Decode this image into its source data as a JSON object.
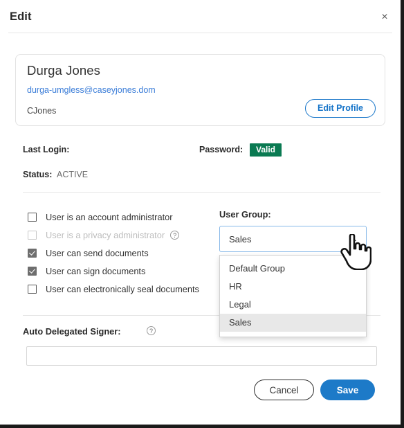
{
  "header": {
    "title": "Edit",
    "close_label": "×"
  },
  "profile": {
    "name": "Durga Jones",
    "email": "durga-umgless@caseyjones.dom",
    "username": "CJones",
    "edit_button_label": "Edit Profile"
  },
  "meta": {
    "last_login_label": "Last Login:",
    "last_login_value": "",
    "password_label": "Password:",
    "password_status": "Valid",
    "status_label": "Status:",
    "status_value": "ACTIVE"
  },
  "permissions": [
    {
      "label": "User is an account administrator",
      "checked": false,
      "disabled": false,
      "help": false
    },
    {
      "label": "User is a privacy administrator",
      "checked": false,
      "disabled": true,
      "help": true
    },
    {
      "label": "User can send documents",
      "checked": true,
      "disabled": false,
      "help": false
    },
    {
      "label": "User can sign documents",
      "checked": true,
      "disabled": false,
      "help": false
    },
    {
      "label": "User can electronically seal documents",
      "checked": false,
      "disabled": false,
      "help": false
    }
  ],
  "user_group": {
    "label": "User Group:",
    "selected": "Sales",
    "expanded": true,
    "options": [
      "Default Group",
      "HR",
      "Legal",
      "Sales"
    ]
  },
  "auto_delegated_signer": {
    "label": "Auto Delegated Signer:",
    "value": "",
    "placeholder": "",
    "help_glyph": "?"
  },
  "footer": {
    "cancel_label": "Cancel",
    "save_label": "Save"
  },
  "icons": {
    "help_glyph": "?"
  },
  "colors": {
    "accent_blue": "#1473c8",
    "save_blue": "#1d7ac8",
    "valid_green": "#0a7a52",
    "link_blue": "#3b7dd8",
    "focus_border": "#86b8e8",
    "option_highlight": "#e8e8e8"
  }
}
